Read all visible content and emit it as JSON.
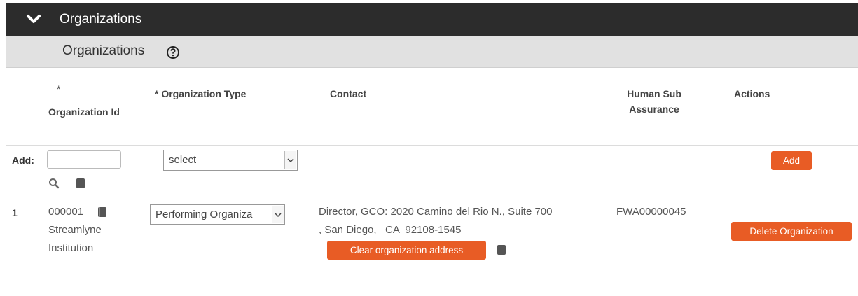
{
  "section": {
    "title": "Organizations"
  },
  "subsection": {
    "title": "Organizations"
  },
  "columns": {
    "org_id_req": "*",
    "org_id": "Organization Id",
    "org_type": "* Organization Type",
    "contact": "Contact",
    "human_sub": "Human Sub Assurance",
    "actions": "Actions"
  },
  "add_row": {
    "label": "Add:",
    "id_value": "",
    "type_selected": "select",
    "add_button": "Add"
  },
  "rows": [
    {
      "index": "1",
      "org_id": "000001",
      "org_name_line1": "Streamlyne",
      "org_name_line2": "Institution",
      "org_type": "Performing Organiza",
      "contact_line1": "Director, GCO: 2020 Camino del Rio N., Suite 700",
      "contact_line2": ", San Diego,   CA  92108-1545",
      "clear_button": "Clear organization address",
      "human_sub": "FWA00000045",
      "delete_button": "Delete Organization"
    }
  ],
  "colors": {
    "accent": "#e85c25",
    "topbar": "#2c2c2c",
    "subbar": "#e1e1e1"
  }
}
